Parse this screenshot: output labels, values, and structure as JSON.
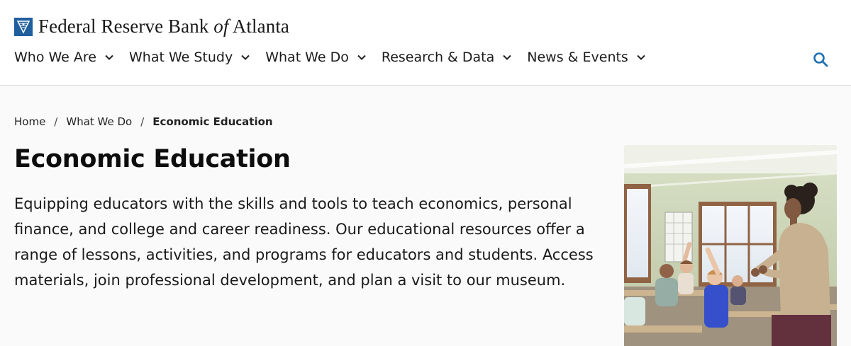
{
  "brand": {
    "name_part1": "Federal Reserve Bank ",
    "name_of": "of",
    "name_part2": " Atlanta",
    "logo_icon": "eagle-seal-icon"
  },
  "nav": {
    "items": [
      {
        "label": "Who We Are"
      },
      {
        "label": "What We Study"
      },
      {
        "label": "What We Do"
      },
      {
        "label": "Research & Data"
      },
      {
        "label": "News & Events"
      }
    ],
    "search_icon": "search-icon"
  },
  "breadcrumb": {
    "items": [
      {
        "label": "Home"
      },
      {
        "label": "What We Do"
      },
      {
        "label": "Economic Education"
      }
    ],
    "separator": "/"
  },
  "page": {
    "title": "Economic Education",
    "intro": "Equipping educators with the skills and tools to teach economics, personal finance, and college and career readiness. Our educational resources offer a range of lessons, activities, and programs for educators and students. Access materials, join professional development, and plan a visit to our museum."
  },
  "colors": {
    "brand_blue": "#1f5f9e",
    "accent_blue": "#1f6fb2",
    "text": "#1a1a1a"
  }
}
